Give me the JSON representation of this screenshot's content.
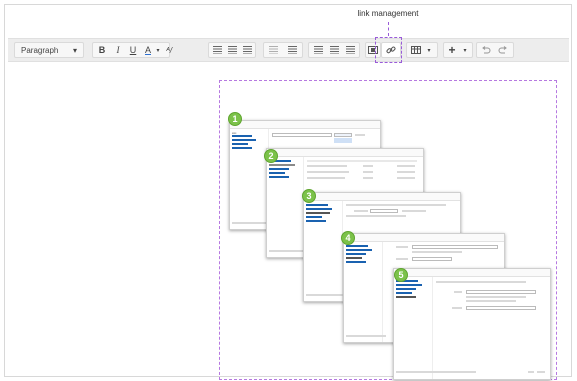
{
  "callout": {
    "label": "link management"
  },
  "toolbar": {
    "paragraph_label": "Paragraph",
    "chevron": "▾",
    "bold": "B",
    "italic": "I",
    "underline": "U",
    "text_color": "A",
    "highlight": "ᴬ/",
    "plus": "+"
  },
  "steps": [
    "1",
    "2",
    "3",
    "4",
    "5"
  ],
  "colors": {
    "accent": "#9a5bd9",
    "badge": "#7cc24a",
    "toolbar": "#ededed"
  }
}
